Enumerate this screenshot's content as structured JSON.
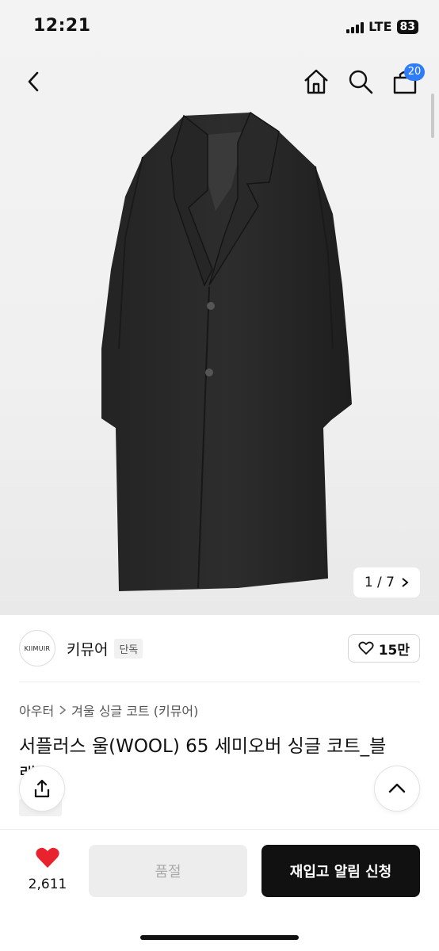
{
  "status": {
    "time": "12:21",
    "network": "LTE",
    "battery": "83"
  },
  "header": {
    "cart_count": "20"
  },
  "gallery": {
    "page": "1 / 7"
  },
  "brand": {
    "logo_text": "KIIMUIR",
    "name": "키뮤어",
    "tag": "단독",
    "likes": "15만"
  },
  "product": {
    "breadcrumb": [
      "아우터",
      "겨울 싱글 코트 (키뮤어)"
    ],
    "title": "서플러스 울(WOOL) 65 세미오버 싱글 코트_블",
    "title_peek": "랙"
  },
  "footer": {
    "heart_count": "2,611",
    "soldout_label": "품절",
    "restock_label": "재입고 알림 신청"
  },
  "colors": {
    "accent": "#2f7df6",
    "heart": "#e8232d",
    "primary_button": "#111111"
  }
}
